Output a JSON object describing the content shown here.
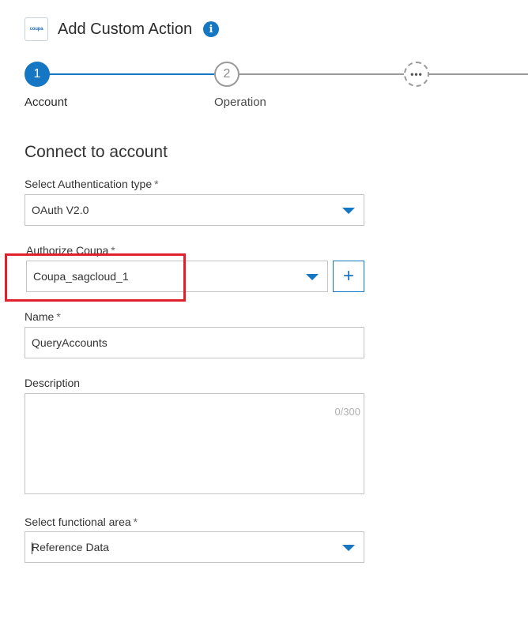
{
  "header": {
    "logo_text": "coupa",
    "title": "Add Custom Action",
    "info_icon": "i"
  },
  "stepper": {
    "steps": [
      {
        "number": "1",
        "label": "Account",
        "state": "active"
      },
      {
        "number": "2",
        "label": "Operation",
        "state": "pending"
      },
      {
        "number": "•••",
        "label": "",
        "state": "more"
      }
    ]
  },
  "form": {
    "section_title": "Connect to account",
    "auth_type": {
      "label": "Select Authentication type",
      "required_mark": "*",
      "value": "OAuth V2.0"
    },
    "authorize": {
      "label": "Authorize Coupa",
      "required_mark": "*",
      "value": "Coupa_sagcloud_1",
      "add_button": "+"
    },
    "name": {
      "label": "Name",
      "required_mark": "*",
      "value": "QueryAccounts"
    },
    "description": {
      "label": "Description",
      "value": "",
      "counter": "0/300"
    },
    "functional_area": {
      "label": "Select functional area",
      "required_mark": "*",
      "value": "Reference Data"
    }
  },
  "colors": {
    "accent": "#1576c3",
    "highlight": "#e0202c",
    "border": "#c4c4c4"
  }
}
